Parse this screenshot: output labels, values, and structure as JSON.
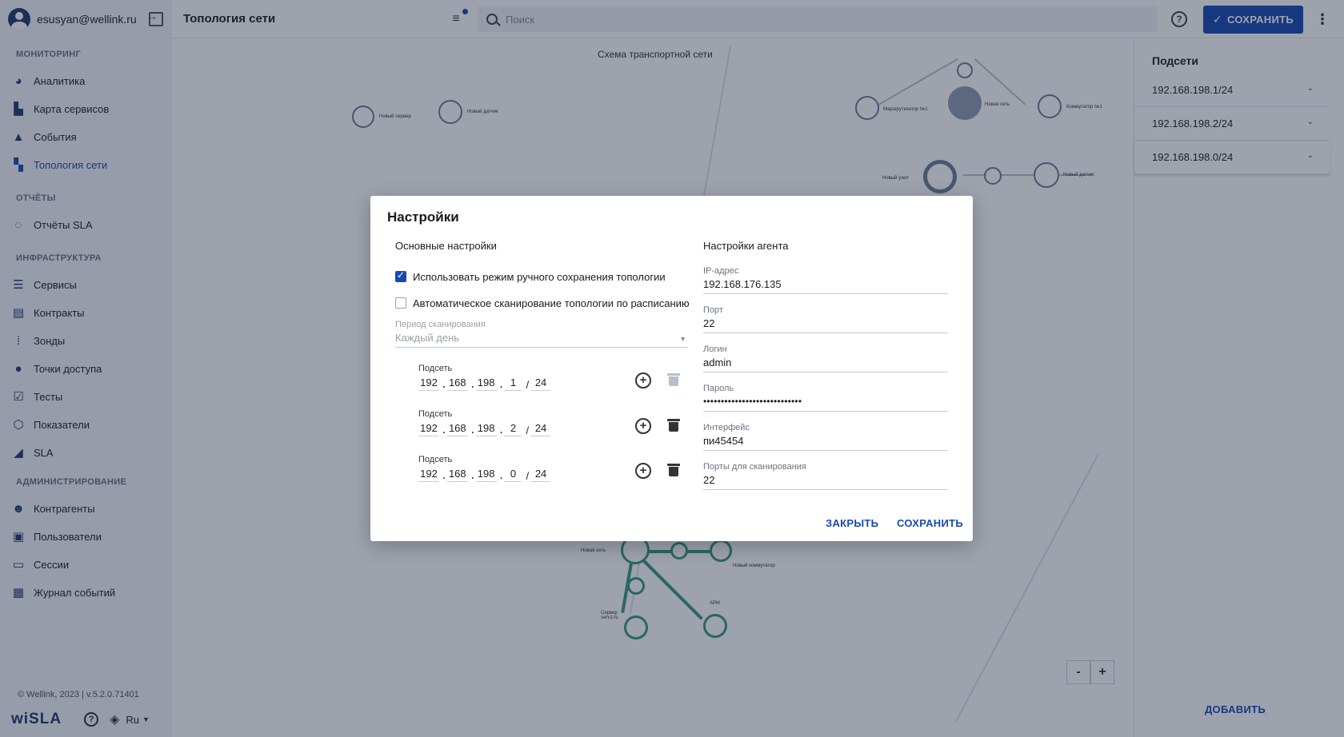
{
  "user": {
    "email": "esusyan@wellink.ru"
  },
  "topbar": {
    "title": "Топология сети",
    "search_placeholder": "Поиск",
    "save_label": "СОХРАНИТЬ"
  },
  "sidebar": {
    "sections": [
      {
        "title": "МОНИТОРИНГ",
        "items": [
          "Аналитика",
          "Карта сервисов",
          "События",
          "Топология сети"
        ]
      },
      {
        "title": "ОТЧЁТЫ",
        "items": [
          "Отчёты SLA"
        ]
      },
      {
        "title": "ИНФРАСТРУКТУРА",
        "items": [
          "Сервисы",
          "Контракты",
          "Зонды",
          "Точки доступа",
          "Тесты",
          "Показатели",
          "SLA"
        ]
      },
      {
        "title": "АДМИНИСТРИРОВАНИЕ",
        "items": [
          "Контрагенты",
          "Пользователи",
          "Сессии",
          "Журнал событий"
        ]
      }
    ],
    "active_item": "Топология сети",
    "copyright": "© Wellink, 2023 | v.5.2.0.71401",
    "brand": "wiSLA",
    "language": "Ru"
  },
  "canvas": {
    "title": "Схема транспортной сети",
    "nodes": {
      "server_new": "Новый сервер",
      "sensor_new": "Новый датчик",
      "router": "Маршрутизатор №1",
      "network_new": "Новая сеть",
      "switch": "Коммутатор №1",
      "node_new": "Новый узел",
      "sensor_new_2": "Новый датчик",
      "network_bottom": "Новая сеть",
      "switch_new": "Новый коммутатор",
      "server_bottom": "Сервер serv1.ru",
      "arm": "АРМ"
    },
    "zoom_out": "-",
    "zoom_in": "+"
  },
  "right_panel": {
    "title": "Подсети",
    "subnets": [
      "192.168.198.1/24",
      "192.168.198.2/24",
      "192.168.198.0/24"
    ],
    "add_label": "ДОБАВИТЬ"
  },
  "modal": {
    "title": "Настройки",
    "basic": {
      "title": "Основные настройки",
      "manual_save_label": "Использовать режим ручного сохранения топологии",
      "manual_save_checked": true,
      "auto_scan_label": "Автоматическое сканирование топологии по расписанию",
      "auto_scan_checked": false,
      "period_label": "Период сканирования",
      "period_value": "Каждый день",
      "subnet_label": "Подсеть",
      "subnets": [
        {
          "o1": "192",
          "o2": "168",
          "o3": "198",
          "o4": "1",
          "mask": "24"
        },
        {
          "o1": "192",
          "o2": "168",
          "o3": "198",
          "o4": "2",
          "mask": "24"
        },
        {
          "o1": "192",
          "o2": "168",
          "o3": "198",
          "o4": "0",
          "mask": "24"
        }
      ]
    },
    "agent": {
      "title": "Настройки агента",
      "ip_label": "IP-адрес",
      "ip": "192.168.176.135",
      "port_label": "Порт",
      "port": "22",
      "login_label": "Логин",
      "login": "admin",
      "password_label": "Пароль",
      "password": "••••••••••••••••••••••••••••",
      "interface_label": "Интерфейс",
      "interface": "пи45454",
      "scan_ports_label": "Порты для сканирования",
      "scan_ports": "22"
    },
    "close_label": "ЗАКРЫТЬ",
    "save_label": "СОХРАНИТЬ"
  }
}
